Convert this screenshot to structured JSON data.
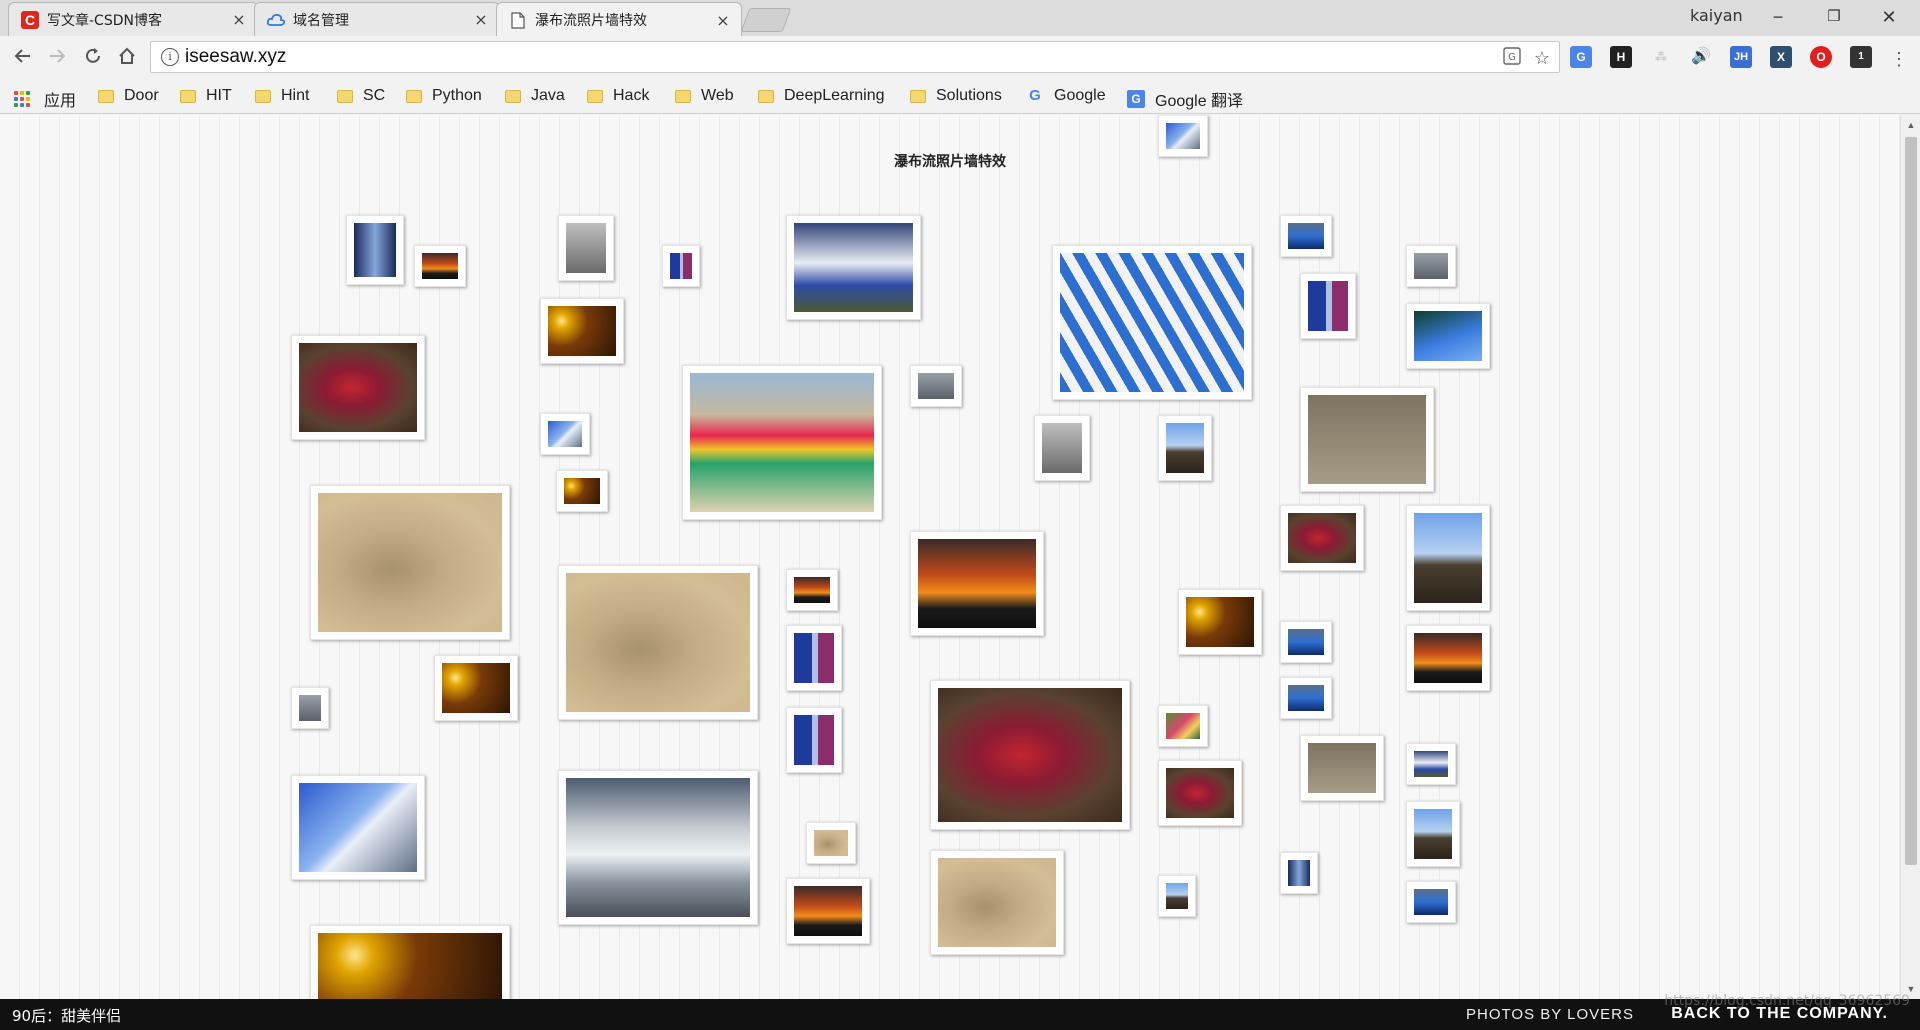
{
  "browser": {
    "tabs": [
      {
        "label": "写文章-CSDN博客",
        "icon": "csdn-icon",
        "active": false
      },
      {
        "label": "域名管理",
        "icon": "cloud-icon",
        "active": false
      },
      {
        "label": "瀑布流照片墙特效",
        "icon": "page-icon",
        "active": true
      }
    ],
    "close_glyph": "×",
    "profile_name": "kaiyan",
    "window_controls": {
      "minimize": "−",
      "restore": "❐",
      "close": "✕"
    },
    "url": "iseesaw.xyz",
    "info_glyph": "i",
    "extensions": [
      {
        "name": "google-translate-ext",
        "text": "G",
        "color": "#4a86e8"
      },
      {
        "name": "stickies-ext",
        "text": "H",
        "color": "#222222"
      },
      {
        "name": "blank-ext",
        "text": "⁂",
        "color": "#cccccc"
      },
      {
        "name": "sound-ext",
        "text": "🔊",
        "color": "#333333"
      },
      {
        "name": "jh-ext",
        "text": "JH",
        "color": "#3b6fd6"
      },
      {
        "name": "x-ext",
        "text": "X",
        "color": "#2f4f6f"
      },
      {
        "name": "opera-ext",
        "text": "O",
        "color": "#e02020"
      },
      {
        "name": "game-ext",
        "text": "1",
        "color": "#333333"
      }
    ],
    "bookmarks": [
      {
        "label": "应用",
        "type": "apps"
      },
      {
        "label": "Door",
        "type": "folder"
      },
      {
        "label": "HIT",
        "type": "folder"
      },
      {
        "label": "Hint",
        "type": "folder"
      },
      {
        "label": "SC",
        "type": "folder"
      },
      {
        "label": "Python",
        "type": "folder"
      },
      {
        "label": "Java",
        "type": "folder"
      },
      {
        "label": "Hack",
        "type": "folder"
      },
      {
        "label": "Web",
        "type": "folder"
      },
      {
        "label": "DeepLearning",
        "type": "folder"
      },
      {
        "label": "Solutions",
        "type": "folder"
      },
      {
        "label": "Google",
        "type": "google"
      },
      {
        "label": "Google 翻译",
        "type": "translate"
      }
    ]
  },
  "page": {
    "title": "瀑布流照片墙特效",
    "photos": [
      {
        "subject": "tower"
      },
      {
        "subject": "sunset"
      },
      {
        "subject": "balcony"
      },
      {
        "subject": "door"
      },
      {
        "subject": "boat"
      },
      {
        "subject": "chairs"
      },
      {
        "subject": "pool"
      },
      {
        "subject": "grey"
      },
      {
        "subject": "lights"
      },
      {
        "subject": "door"
      },
      {
        "subject": "palm"
      },
      {
        "subject": "dance"
      },
      {
        "subject": "kayak"
      },
      {
        "subject": "grey"
      },
      {
        "subject": "balcony"
      },
      {
        "subject": "mountain"
      },
      {
        "subject": "chairs2"
      },
      {
        "subject": "building"
      },
      {
        "subject": "lights"
      },
      {
        "subject": "sand"
      },
      {
        "subject": "sunset"
      },
      {
        "subject": "building"
      },
      {
        "subject": "dance"
      },
      {
        "subject": "mountain"
      },
      {
        "subject": "sand"
      },
      {
        "subject": "sunset"
      },
      {
        "subject": "lights"
      },
      {
        "subject": "door"
      },
      {
        "subject": "pool"
      },
      {
        "subject": "sunset"
      },
      {
        "subject": "grey"
      },
      {
        "subject": "lights"
      },
      {
        "subject": "door"
      },
      {
        "subject": "dance"
      },
      {
        "subject": "pool"
      },
      {
        "subject": "flowers"
      },
      {
        "subject": "chairs2"
      },
      {
        "subject": "boat"
      },
      {
        "subject": "building"
      },
      {
        "subject": "sea"
      },
      {
        "subject": "sand"
      },
      {
        "subject": "dance"
      },
      {
        "subject": "mountain"
      },
      {
        "subject": "sunset"
      },
      {
        "subject": "sand"
      },
      {
        "subject": "mountain"
      },
      {
        "subject": "tower"
      },
      {
        "subject": "pool"
      },
      {
        "subject": "lights"
      }
    ]
  },
  "footer": {
    "left_text": "90后：甜美伴侣",
    "photos_by": "PHOTOS BY LOVERS",
    "back_link": "BACK TO THE COMPANY.",
    "watermark": "https://blog.csdn.net/qq_36962569"
  },
  "scrollbar": {
    "up": "▲",
    "down": "▼"
  }
}
